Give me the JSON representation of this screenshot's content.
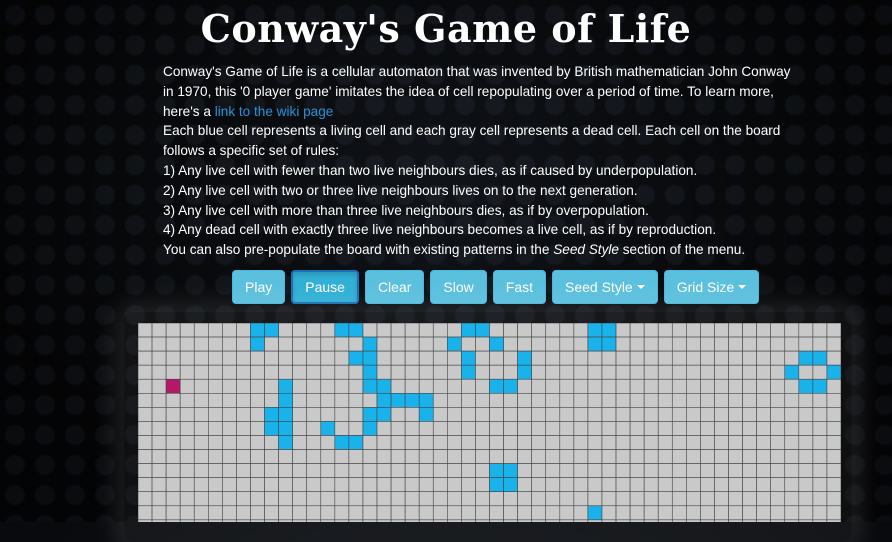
{
  "title": "Conway's Game of Life",
  "intro": {
    "p1_before_link": "Conway's Game of Life is a cellular automaton that was invented by British mathematician John Conway in 1970, this '0 player game' imitates the idea of cell repopulating over a period of time. To learn more, here's a ",
    "link_text": "link to the wiki page",
    "p2": "Each blue cell represents a living cell and each gray cell represents a dead cell. Each cell on the board follows a specific set of rules:",
    "rules": [
      "1) Any live cell with fewer than two live neighbours dies, as if caused by underpopulation.",
      "2) Any live cell with two or three live neighbours lives on to the next generation.",
      "3) Any live cell with more than three live neighbours dies, as if by overpopulation.",
      "4) Any dead cell with exactly three live neighbours becomes a live cell, as if by reproduction."
    ],
    "seed_before": "You can also pre-populate the board with existing patterns in the ",
    "seed_em": "Seed Style",
    "seed_after": " section of the menu."
  },
  "toolbar": {
    "play": "Play",
    "pause": "Pause",
    "clear": "Clear",
    "slow": "Slow",
    "fast": "Fast",
    "seed_style": "Seed Style",
    "grid_size": "Grid Size"
  },
  "colors": {
    "live": "#1ab2ea",
    "dead": "#c9c9c9",
    "highlight": "#b5176b",
    "grid_line": "#444444"
  },
  "board": {
    "cols": 50,
    "visible_rows": 14,
    "live_cells": [
      [
        8,
        0
      ],
      [
        9,
        0
      ],
      [
        14,
        0
      ],
      [
        15,
        0
      ],
      [
        23,
        0
      ],
      [
        24,
        0
      ],
      [
        32,
        0
      ],
      [
        33,
        0
      ],
      [
        8,
        1
      ],
      [
        16,
        1
      ],
      [
        22,
        1
      ],
      [
        25,
        1
      ],
      [
        32,
        1
      ],
      [
        33,
        1
      ],
      [
        15,
        2
      ],
      [
        16,
        2
      ],
      [
        23,
        2
      ],
      [
        27,
        2
      ],
      [
        47,
        2
      ],
      [
        48,
        2
      ],
      [
        16,
        3
      ],
      [
        23,
        3
      ],
      [
        27,
        3
      ],
      [
        46,
        3
      ],
      [
        49,
        3
      ],
      [
        10,
        4
      ],
      [
        16,
        4
      ],
      [
        17,
        4
      ],
      [
        25,
        4
      ],
      [
        26,
        4
      ],
      [
        47,
        4
      ],
      [
        48,
        4
      ],
      [
        10,
        5
      ],
      [
        17,
        5
      ],
      [
        18,
        5
      ],
      [
        19,
        5
      ],
      [
        20,
        5
      ],
      [
        9,
        6
      ],
      [
        10,
        6
      ],
      [
        16,
        6
      ],
      [
        17,
        6
      ],
      [
        20,
        6
      ],
      [
        9,
        7
      ],
      [
        10,
        7
      ],
      [
        13,
        7
      ],
      [
        16,
        7
      ],
      [
        10,
        8
      ],
      [
        14,
        8
      ],
      [
        15,
        8
      ],
      [
        25,
        10
      ],
      [
        26,
        10
      ],
      [
        25,
        11
      ],
      [
        26,
        11
      ],
      [
        32,
        13
      ]
    ],
    "highlight_cells": [
      [
        2,
        4
      ]
    ]
  }
}
